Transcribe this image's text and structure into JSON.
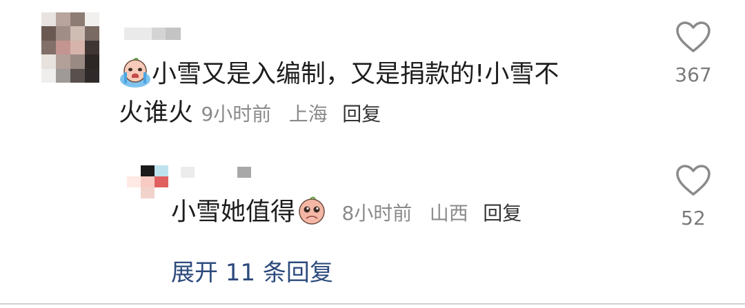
{
  "main_comment": {
    "text_line1": "小雪又是入编制，又是捐款的!小雪不",
    "text_line2": "火谁火",
    "time": "9小时前",
    "location": "上海",
    "reply_label": "回复",
    "emoji": "crying-emoji",
    "like_count": "367"
  },
  "reply_comment": {
    "text": "小雪她值得",
    "emoji": "pleading-emoji",
    "time": "8小时前",
    "location": "山西",
    "reply_label": "回复",
    "like_count": "52"
  },
  "expand": {
    "label": "展开 11 条回复"
  },
  "colors": {
    "text": "#1d1d1d",
    "meta": "#8a8a8a",
    "link": "#2c4a7c",
    "heart_stroke": "#8a8a8a"
  },
  "icons": [
    "crying-emoji",
    "pleading-emoji",
    "heart-icon"
  ]
}
